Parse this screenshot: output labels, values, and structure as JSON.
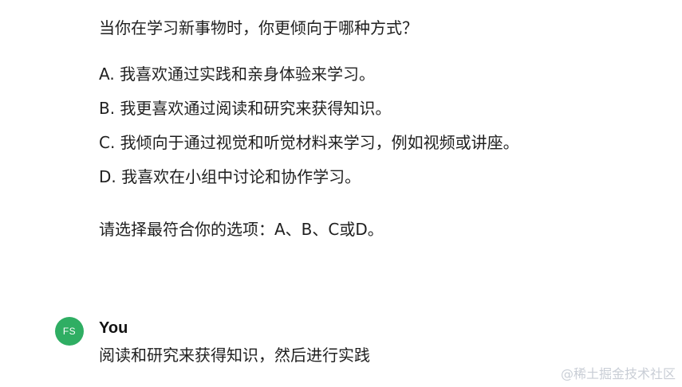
{
  "assistant": {
    "question": "当你在学习新事物时，你更倾向于哪种方式？",
    "options": [
      "A. 我喜欢通过实践和亲身体验来学习。",
      "B. 我更喜欢通过阅读和研究来获得知识。",
      "C. 我倾向于通过视觉和听觉材料来学习，例如视频或讲座。",
      "D. 我喜欢在小组中讨论和协作学习。"
    ],
    "prompt": "请选择最符合你的选项：A、B、C或D。"
  },
  "user": {
    "avatar_initials": "FS",
    "avatar_color": "#2fae63",
    "name": "You",
    "message": "阅读和研究来获得知识，然后进行实践"
  },
  "watermark": "@稀土掘金技术社区"
}
